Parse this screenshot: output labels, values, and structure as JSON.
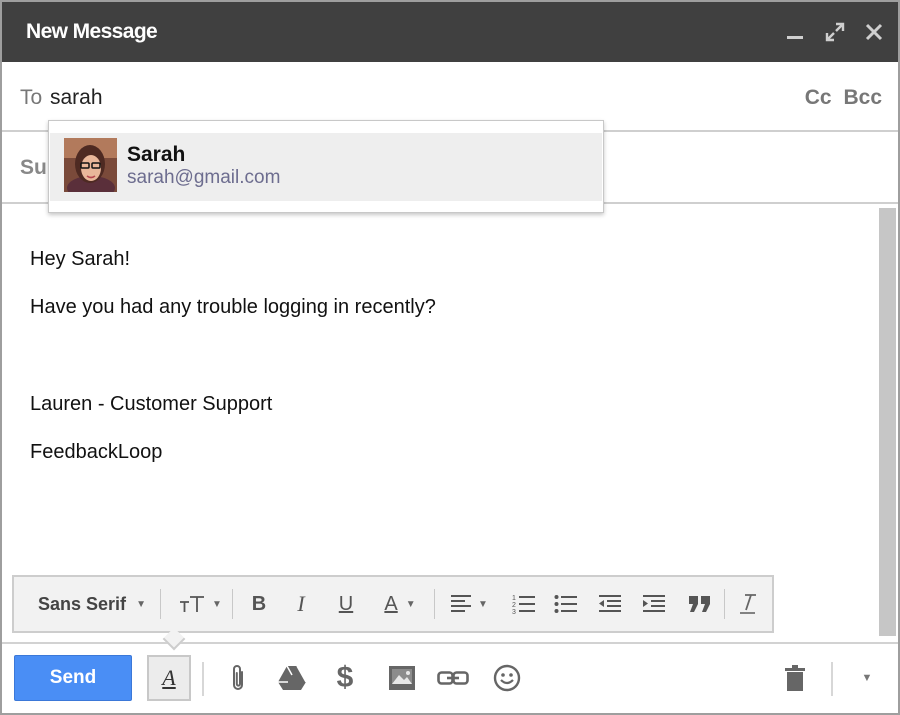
{
  "window": {
    "title": "New Message"
  },
  "header": {
    "icons": [
      "minimize-icon",
      "expand-icon",
      "close-icon"
    ]
  },
  "recipients": {
    "to_label": "To",
    "to_value": "sarah",
    "cc_label": "Cc",
    "bcc_label": "Bcc"
  },
  "subject": {
    "label_partial": "Su"
  },
  "autocomplete": {
    "name": "Sarah",
    "email": "sarah@gmail.com"
  },
  "body": {
    "lines": [
      "Hey Sarah!",
      "Have you had any trouble logging in recently?",
      "Lauren - Customer Support",
      "FeedbackLoop"
    ]
  },
  "format_toolbar": {
    "font_name": "Sans Serif",
    "bold": "B",
    "italic": "I",
    "underline": "U",
    "text_color": "A",
    "icons": [
      "font-size-icon",
      "bold-icon",
      "italic-icon",
      "underline-icon",
      "text-color-icon",
      "align-icon",
      "numbered-list-icon",
      "bulleted-list-icon",
      "indent-less-icon",
      "indent-more-icon",
      "quote-icon",
      "remove-formatting-icon"
    ]
  },
  "bottom_toolbar": {
    "send_label": "Send",
    "format_toggle_letter": "A",
    "money_symbol": "$",
    "icons": [
      "attach-icon",
      "drive-icon",
      "money-icon",
      "photo-icon",
      "link-icon",
      "emoji-icon",
      "trash-icon",
      "more-options-icon"
    ]
  },
  "colors": {
    "header_bg": "#404040",
    "send_button": "#4a8ef5",
    "email_text": "#6d6d8f"
  }
}
